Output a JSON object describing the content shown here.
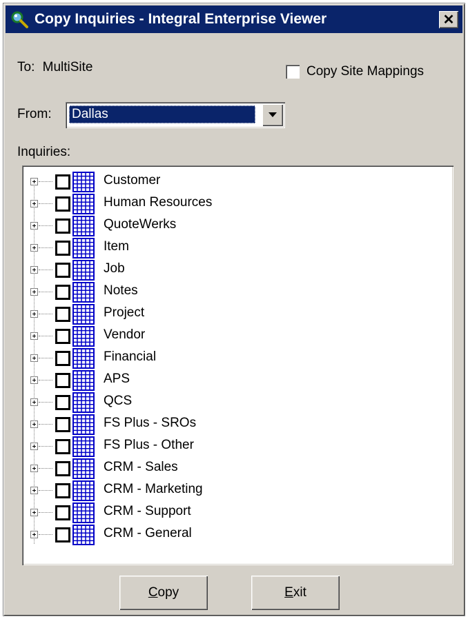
{
  "window": {
    "title": "Copy Inquiries - Integral Enterprise Viewer",
    "close_label": "✕",
    "colors": {
      "titlebar": "#0a246a",
      "face": "#d4d0c8",
      "highlight": "#0a246a"
    }
  },
  "to": {
    "label": "To:",
    "value": "MultiSite"
  },
  "copy_site_mappings": {
    "label": "Copy Site Mappings",
    "checked": false
  },
  "from": {
    "label": "From:",
    "selected": "Dallas"
  },
  "inquiries": {
    "label": "Inquiries:",
    "items": [
      {
        "label": "Customer",
        "checked": false
      },
      {
        "label": "Human Resources",
        "checked": false
      },
      {
        "label": "QuoteWerks",
        "checked": false
      },
      {
        "label": "Item",
        "checked": false
      },
      {
        "label": "Job",
        "checked": false
      },
      {
        "label": "Notes",
        "checked": false
      },
      {
        "label": "Project",
        "checked": false
      },
      {
        "label": "Vendor",
        "checked": false
      },
      {
        "label": "Financial",
        "checked": false
      },
      {
        "label": "APS",
        "checked": false
      },
      {
        "label": "QCS",
        "checked": false
      },
      {
        "label": "FS Plus - SROs",
        "checked": false
      },
      {
        "label": "FS Plus - Other",
        "checked": false
      },
      {
        "label": "CRM - Sales",
        "checked": false
      },
      {
        "label": "CRM - Marketing",
        "checked": false
      },
      {
        "label": "CRM - Support",
        "checked": false
      },
      {
        "label": "CRM - General",
        "checked": false
      }
    ]
  },
  "buttons": {
    "copy": {
      "mnemonic": "C",
      "rest": "opy"
    },
    "exit": {
      "mnemonic": "E",
      "rest": "xit"
    }
  }
}
